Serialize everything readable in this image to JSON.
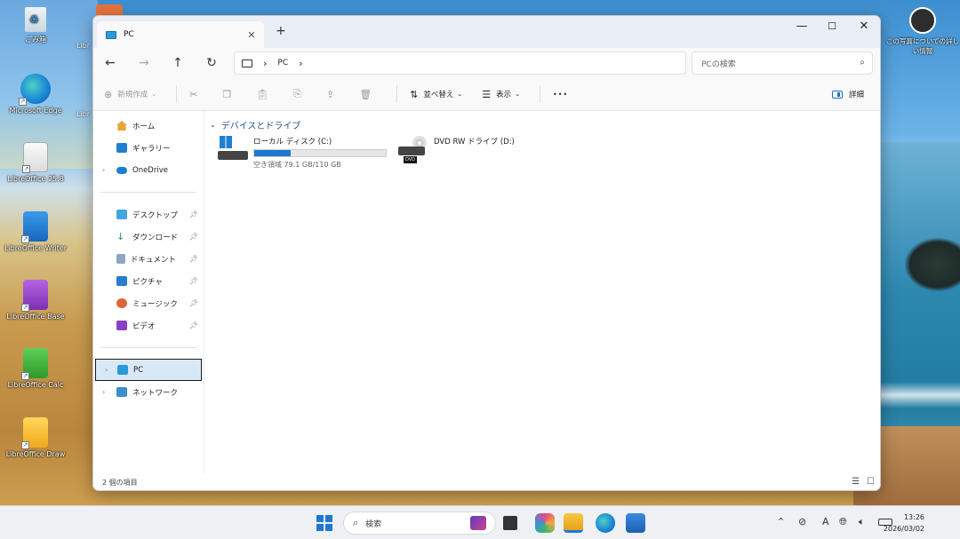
{
  "desktop": {
    "icons": [
      {
        "label": "ごみ箱"
      },
      {
        "label": "Microsoft Edge"
      },
      {
        "label": "LibreOffice 25.8"
      },
      {
        "label": "LibreOffice Writer"
      },
      {
        "label": "LibreOffice Base"
      },
      {
        "label": "LibreOffice Calc"
      },
      {
        "label": "LibreOffice Draw"
      },
      {
        "label": "この写真についての詳しい情報"
      }
    ],
    "partial_labels": [
      "Libr",
      "Libr"
    ]
  },
  "window": {
    "tab_title": "PC",
    "new_tab": "+",
    "controls": {
      "minimize": "—",
      "maximize": "☐",
      "close": "✕"
    },
    "nav": {
      "back": "←",
      "forward": "→",
      "up": "↑",
      "refresh": "↻"
    },
    "address": {
      "segment": "PC",
      "chevron": "›"
    },
    "search_placeholder": "PCの検索"
  },
  "toolbar": {
    "new": "新規作成",
    "sort": "並べ替え",
    "view": "表示",
    "more": "•••",
    "details": "詳細"
  },
  "sidebar": {
    "items": [
      {
        "label": "ホーム"
      },
      {
        "label": "ギャラリー"
      },
      {
        "label": "OneDrive"
      },
      {
        "label": "デスクトップ"
      },
      {
        "label": "ダウンロード"
      },
      {
        "label": "ドキュメント"
      },
      {
        "label": "ピクチャ"
      },
      {
        "label": "ミュージック"
      },
      {
        "label": "ビデオ"
      },
      {
        "label": "PC"
      },
      {
        "label": "ネットワーク"
      }
    ]
  },
  "content": {
    "group_header": "デバイスとドライブ",
    "drives": [
      {
        "name": "ローカル ディスク (C:)",
        "free_text": "空き領域 79.1 GB/110 GB",
        "used_fraction": 0.28
      },
      {
        "name": "DVD RW ドライブ (D:)",
        "badge": "DVD"
      }
    ]
  },
  "status": {
    "item_count": "2 個の項目"
  },
  "taskbar": {
    "search_label": "検索",
    "time": "13:26",
    "date": "2026/03/02",
    "ime": "A"
  },
  "colors": {
    "accent": "#1e78d2",
    "selection": "#d9e8f7"
  }
}
